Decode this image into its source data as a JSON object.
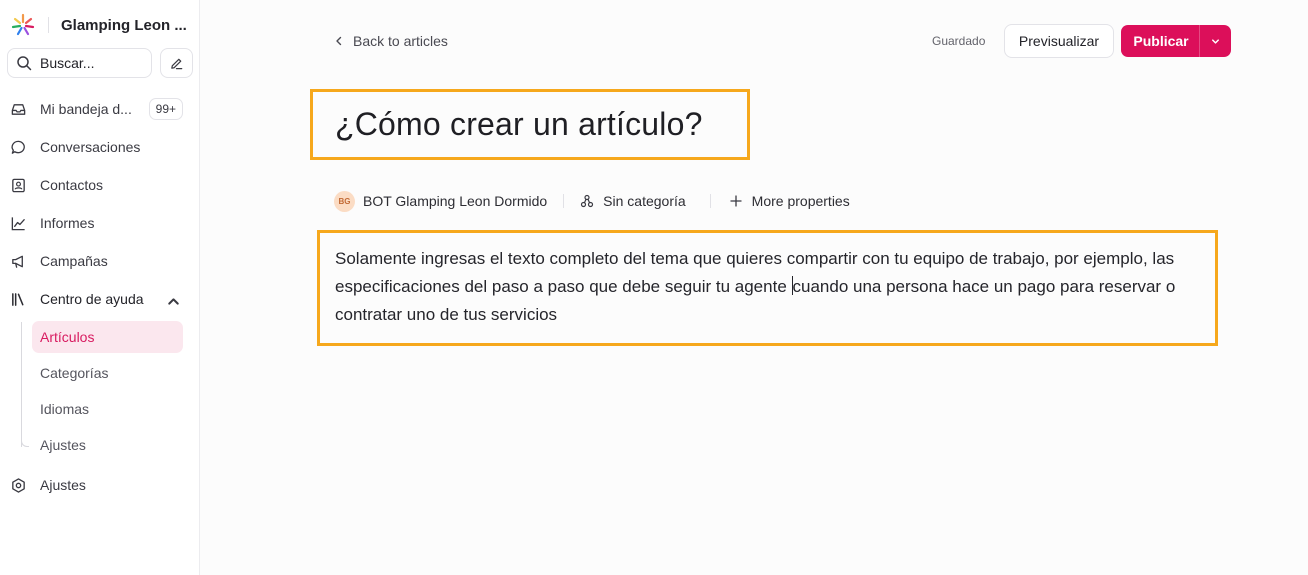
{
  "brand": {
    "name": "Glamping Leon ...",
    "logo_icon": "rainbow-star-logo"
  },
  "search": {
    "placeholder": "Buscar..."
  },
  "nav": {
    "inbox": {
      "label": "Mi bandeja d...",
      "badge": "99+"
    },
    "conversations": "Conversaciones",
    "contacts": "Contactos",
    "reports": "Informes",
    "campaigns": "Campañas",
    "help_center": "Centro de ayuda",
    "help_sub": [
      "Artículos",
      "Categorías",
      "Idiomas",
      "Ajustes"
    ],
    "settings": "Ajustes"
  },
  "toolbar": {
    "back_label": "Back to articles",
    "status": "Guardado",
    "preview_label": "Previsualizar",
    "publish_label": "Publicar"
  },
  "article": {
    "title": "¿Cómo crear un artículo?",
    "author_initials": "BG",
    "author": "BOT Glamping Leon Dormido",
    "category": "Sin categoría",
    "more_properties": "More properties",
    "body_before_cursor": "Solamente ingresas el texto completo del tema que quieres compartir con tu equipo de trabajo, por ejemplo, las especificaciones del paso a paso que debe seguir tu agente ",
    "body_after_cursor": "cuando una persona hace un pago para reservar o contratar uno de tus servicios"
  },
  "colors": {
    "accent": "#dc0f5a",
    "highlight_border": "#f6a81c",
    "active_bg": "#fbe7ee"
  }
}
